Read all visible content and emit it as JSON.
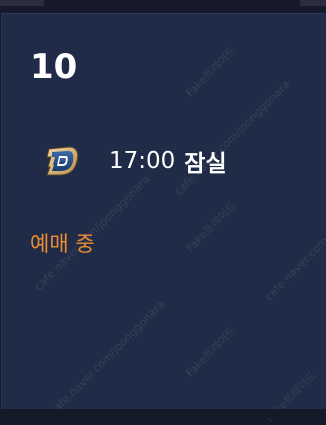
{
  "schedule": {
    "date": "10",
    "game": {
      "team_logo": "nc-dinos-logo",
      "time": "17:00",
      "venue": "잠실"
    },
    "status": "예매 중",
    "status_color": "#ee8c33"
  },
  "watermarks": [
    {
      "text": "cafe.naver.com/joonggonara"
    },
    {
      "text": "Fake트레이드"
    },
    {
      "text": "cafe.naver.com/joonggonara"
    },
    {
      "text": "Fake트레이드"
    },
    {
      "text": "cafe.naver.com/joonggonara"
    },
    {
      "text": "Fake트레이드"
    },
    {
      "text": "cafe.naver.com/joonggonara"
    },
    {
      "text": "Fake트레이드"
    }
  ]
}
